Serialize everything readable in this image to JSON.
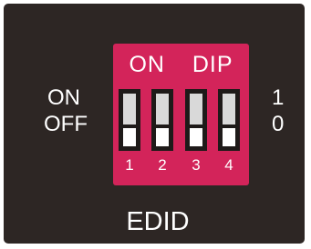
{
  "dip_switch": {
    "header_on": "ON",
    "header_dip": "DIP",
    "switches": [
      {
        "number": "1",
        "state": "OFF"
      },
      {
        "number": "2",
        "state": "OFF"
      },
      {
        "number": "3",
        "state": "OFF"
      },
      {
        "number": "4",
        "state": "OFF"
      }
    ]
  },
  "left_labels": {
    "on": "ON",
    "off": "OFF"
  },
  "right_labels": {
    "one": "1",
    "zero": "0"
  },
  "footer_label": "EDID",
  "colors": {
    "panel": "#2d2624",
    "dip_body": "#d3245a",
    "slot": "#1e1a19",
    "slider_upper": "#d9d9d9",
    "slider_lower": "#ffffff"
  }
}
